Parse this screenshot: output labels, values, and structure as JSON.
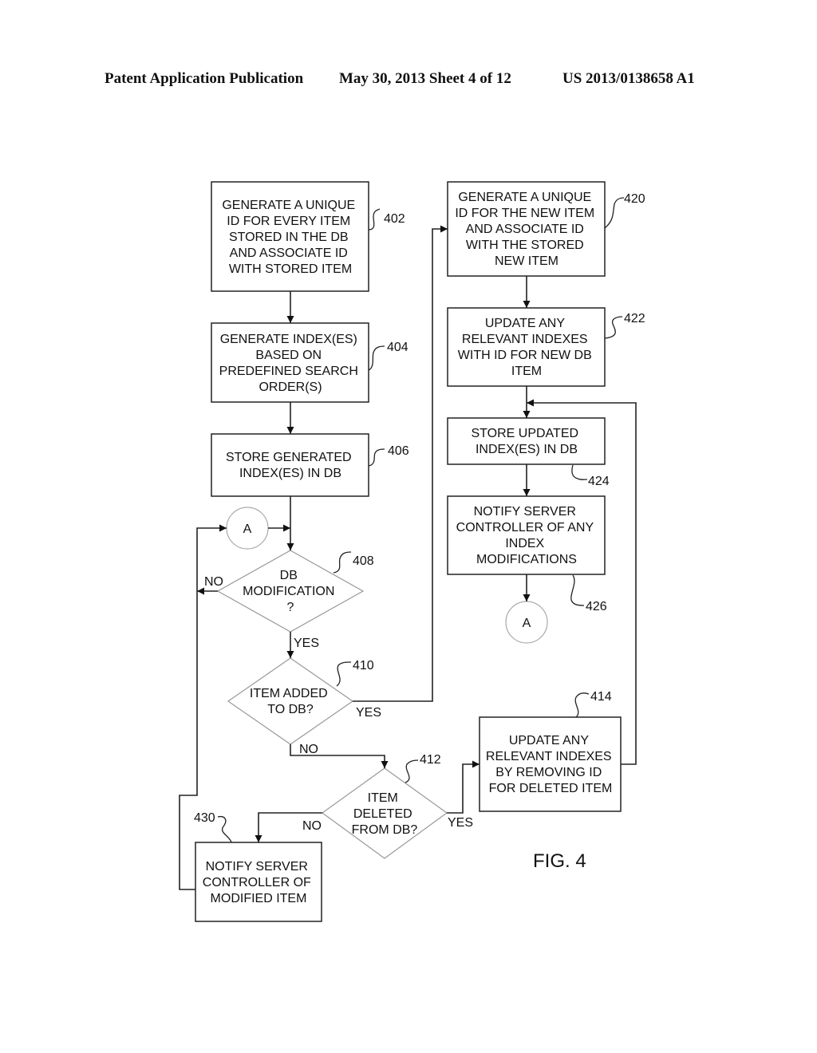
{
  "header": {
    "left": "Patent Application Publication",
    "date_sheet": "May 30, 2013  Sheet 4 of 12",
    "pub_number": "US 2013/0138658 A1"
  },
  "figure": {
    "label": "FIG. 4",
    "steps": {
      "s402": {
        "ref": "402",
        "lines": [
          "GENERATE A UNIQUE",
          "ID FOR EVERY ITEM",
          "STORED IN THE DB",
          "AND ASSOCIATE ID",
          "WITH STORED ITEM"
        ]
      },
      "s404": {
        "ref": "404",
        "lines": [
          "GENERATE INDEX(ES)",
          "BASED ON",
          "PREDEFINED SEARCH",
          "ORDER(S)"
        ]
      },
      "s406": {
        "ref": "406",
        "lines": [
          "STORE GENERATED",
          "INDEX(ES) IN DB"
        ]
      },
      "s408": {
        "ref": "408",
        "lines": [
          "DB",
          "MODIFICATION",
          "?"
        ]
      },
      "s410": {
        "ref": "410",
        "lines": [
          "ITEM ADDED",
          "TO DB?"
        ]
      },
      "s412": {
        "ref": "412",
        "lines": [
          "ITEM",
          "DELETED",
          "FROM DB?"
        ]
      },
      "s414": {
        "ref": "414",
        "lines": [
          "UPDATE ANY",
          "RELEVANT INDEXES",
          "BY REMOVING  ID",
          "FOR DELETED ITEM"
        ]
      },
      "s420": {
        "ref": "420",
        "lines": [
          "GENERATE A UNIQUE",
          "ID FOR THE NEW ITEM",
          "AND ASSOCIATE ID",
          "WITH THE STORED",
          "NEW ITEM"
        ]
      },
      "s422": {
        "ref": "422",
        "lines": [
          "UPDATE ANY",
          "RELEVANT INDEXES",
          "WITH ID FOR NEW DB",
          "ITEM"
        ]
      },
      "s424": {
        "ref": "424",
        "lines": [
          "STORE UPDATED",
          "INDEX(ES) IN DB"
        ]
      },
      "s426": {
        "ref": "426",
        "lines": [
          "NOTIFY SERVER",
          "CONTROLLER OF ANY",
          "INDEX",
          "MODIFICATIONS"
        ]
      },
      "s430": {
        "ref": "430",
        "lines": [
          "NOTIFY SERVER",
          "CONTROLLER OF",
          "MODIFIED ITEM"
        ]
      }
    },
    "connector_label": "A",
    "branch_labels": {
      "no_408": "NO",
      "yes_408": "YES",
      "yes_410": "YES",
      "no_410": "NO",
      "no_412": "NO",
      "yes_412": "YES"
    }
  }
}
